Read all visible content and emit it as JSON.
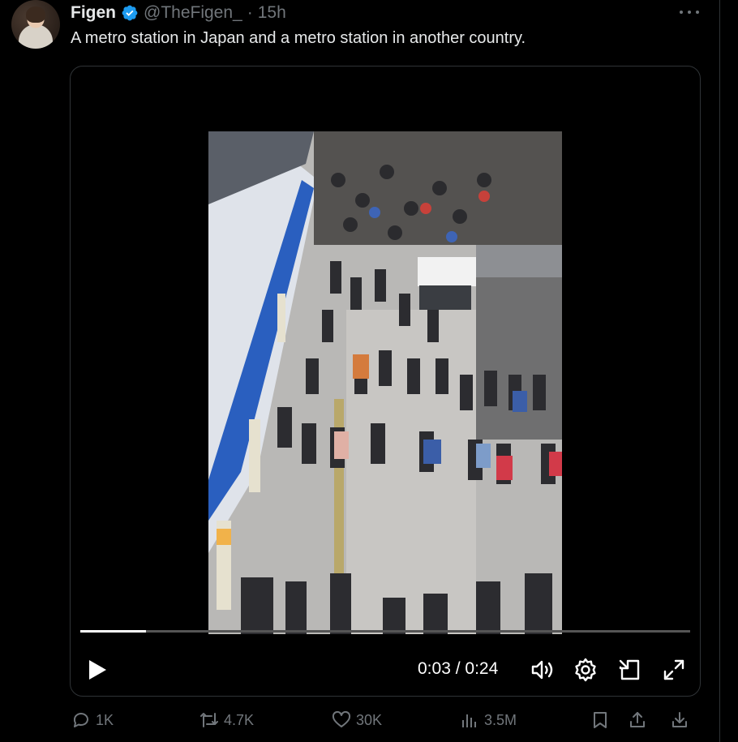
{
  "tweet": {
    "author_name": "Figen",
    "handle": "@TheFigen_",
    "separator": "·",
    "time": "15h",
    "text": "A metro station in Japan and a metro station in another country."
  },
  "video": {
    "current_time": "0:03",
    "time_separator": "/",
    "duration": "0:24",
    "progress": 0.108
  },
  "actions": {
    "replies": "1K",
    "reposts": "4.7K",
    "likes": "30K",
    "views": "3.5M"
  },
  "icons": {
    "verified": "verified-badge-icon",
    "more": "more-options-icon",
    "play": "play-icon",
    "volume": "volume-icon",
    "settings": "settings-gear-icon",
    "pip": "picture-in-picture-icon",
    "fullscreen": "fullscreen-icon",
    "reply": "reply-icon",
    "repost": "repost-icon",
    "like": "heart-icon",
    "views": "views-chart-icon",
    "bookmark": "bookmark-icon",
    "share": "share-icon",
    "download": "download-icon"
  },
  "colors": {
    "background": "#000000",
    "text": "#e7e9ea",
    "muted": "#71767b",
    "verified": "#1d9bf0",
    "border": "#2f3336"
  }
}
